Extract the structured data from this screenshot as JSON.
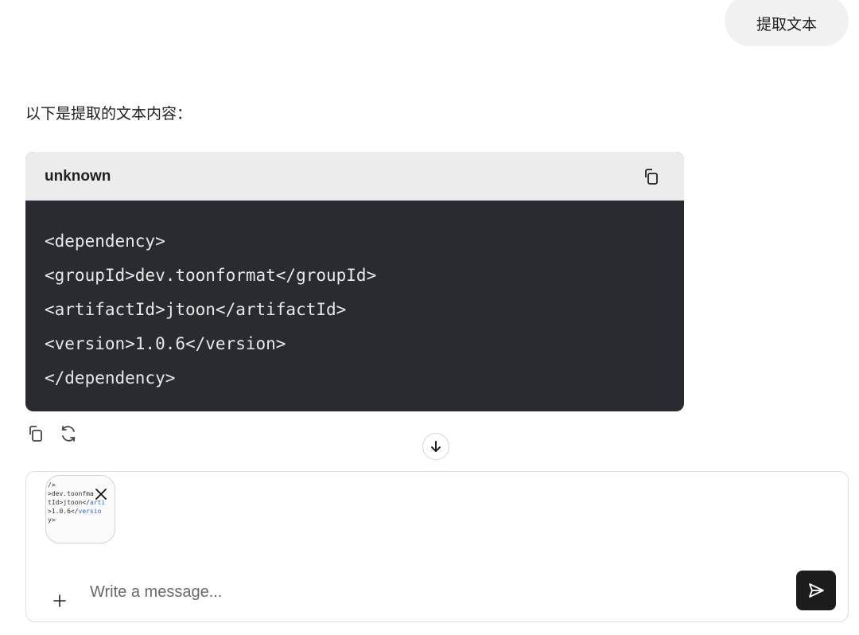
{
  "user_message": {
    "text": "提取文本"
  },
  "assistant": {
    "intro": "以下是提取的文本内容：",
    "code_block": {
      "language": "unknown",
      "copy_icon": "copy-icon",
      "lines": [
        "<dependency>",
        "<groupId>dev.toonformat</groupId>",
        "<artifactId>jtoon</artifactId>",
        "<version>1.0.6</version>",
        "</dependency>"
      ]
    },
    "actions": {
      "copy_icon": "copy-icon",
      "regenerate_icon": "refresh-icon"
    }
  },
  "scroll_down_icon": "arrow-down-icon",
  "composer": {
    "placeholder": "Write a message...",
    "attachment": {
      "preview_lines": [
        "/>",
        ">dev.toonf",
        "tId>jtoon</",
        ">1.0.6</",
        "y>"
      ],
      "preview_tails": [
        "",
        "ma",
        "arti",
        "versio",
        ""
      ],
      "remove_icon": "close-icon"
    },
    "add_icon": "plus-icon",
    "send_icon": "send-icon"
  }
}
